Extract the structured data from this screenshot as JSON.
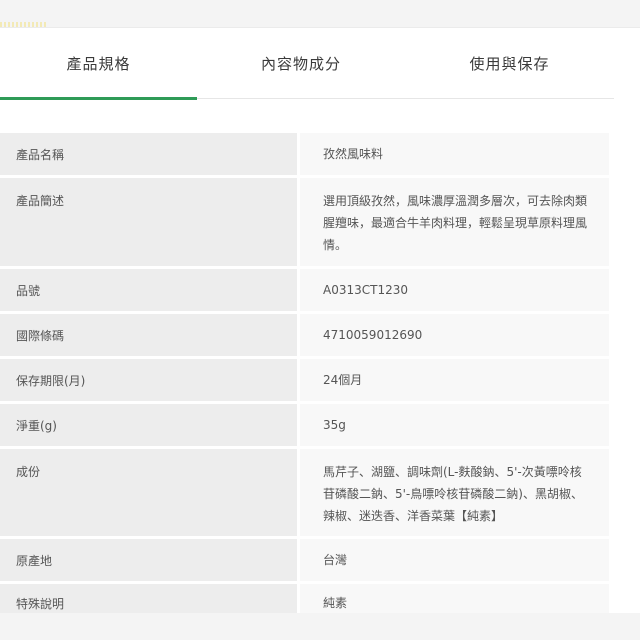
{
  "tabs": [
    {
      "label": "產品規格",
      "active": true
    },
    {
      "label": "內容物成分",
      "active": false
    },
    {
      "label": "使用與保存",
      "active": false
    }
  ],
  "spec_rows": [
    {
      "label": "產品名稱",
      "value": "孜然風味料"
    },
    {
      "label": "產品簡述",
      "value": "選用頂級孜然，風味濃厚溫潤多層次，可去除肉類腥羶味，最適合牛羊肉料理，輕鬆呈現草原料理風情。"
    },
    {
      "label": "品號",
      "value": "A0313CT1230"
    },
    {
      "label": "國際條碼",
      "value": "4710059012690"
    },
    {
      "label": "保存期限(月)",
      "value": "24個月"
    },
    {
      "label": "淨重(g)",
      "value": "35g"
    },
    {
      "label": "成份",
      "value": "馬芹子、湖鹽、調味劑(L-麩酸鈉、5'-次黃嘌呤核苷磷酸二鈉、5'-鳥嘌呤核苷磷酸二鈉)、黑胡椒、辣椒、迷迭香、洋香菜葉【純素】"
    },
    {
      "label": "原產地",
      "value": "台灣"
    },
    {
      "label": "特殊說明",
      "value": "純素"
    }
  ],
  "colors": {
    "accent": "#2e9b57",
    "label_bg": "#ededed",
    "value_bg": "#f8f8f8"
  }
}
